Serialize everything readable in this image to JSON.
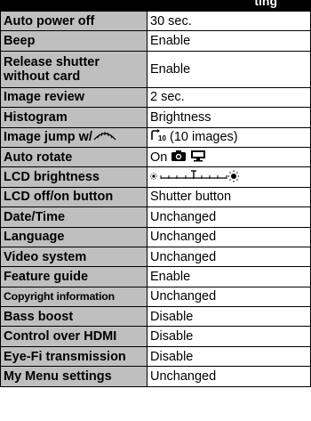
{
  "header": {
    "partial_text": "ting"
  },
  "rows": [
    {
      "setting": "Auto power off",
      "value": "30 sec."
    },
    {
      "setting": "Beep",
      "value": "Enable"
    },
    {
      "setting": "Release shutter without card",
      "value": "Enable"
    },
    {
      "setting": "Image review",
      "value": "2 sec."
    },
    {
      "setting": "Histogram",
      "value": "Brightness"
    },
    {
      "setting": "Image jump w/",
      "setting_icon": "main-dial-icon",
      "value": "(10 images)",
      "value_icon": "jump-10-images-icon"
    },
    {
      "setting": "Auto rotate",
      "value": "On",
      "value_icons": [
        "camera-icon",
        "monitor-icon"
      ]
    },
    {
      "setting": "LCD brightness",
      "value_icon": "brightness-scale-icon",
      "level": 0.5
    },
    {
      "setting": "LCD off/on button",
      "value": "Shutter button"
    },
    {
      "setting": "Date/Time",
      "value": "Unchanged"
    },
    {
      "setting": "Language",
      "value": "Unchanged"
    },
    {
      "setting": "Video system",
      "value": "Unchanged"
    },
    {
      "setting": "Feature guide",
      "value": "Enable"
    },
    {
      "setting": "Copyright information",
      "value": "Unchanged"
    },
    {
      "setting": "Bass boost",
      "value": "Disable"
    },
    {
      "setting": "Control over HDMI",
      "value": "Disable"
    },
    {
      "setting": "Eye-Fi transmission",
      "value": "Disable"
    },
    {
      "setting": "My Menu settings",
      "value": "Unchanged"
    }
  ]
}
